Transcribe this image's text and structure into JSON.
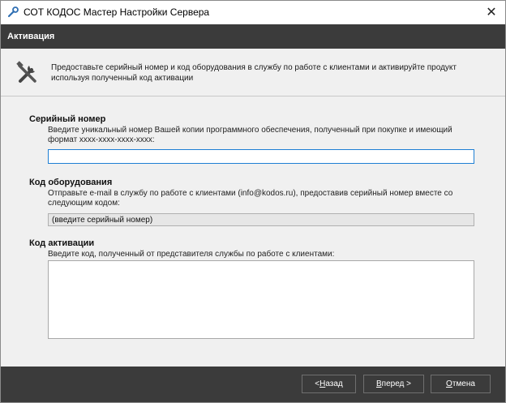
{
  "window": {
    "title": "СОТ КОДОС Мастер Настройки Сервера",
    "close_glyph": "✕"
  },
  "header": {
    "step_title": "Активация"
  },
  "intro": {
    "icon": "tools-icon",
    "text": "Предоставьте серийный номер и код оборудования в службу по работе с клиентами и активируйте продукт используя полученный код активации"
  },
  "serial": {
    "title": "Серийный номер",
    "description": "Введите уникальный номер Вашей копии программного обеспечения, полученный при покупке и имеющий формат xxxx-xxxx-xxxx-xxxx:",
    "value": ""
  },
  "hardware": {
    "title": "Код оборудования",
    "description": "Отправьте e-mail в службу по работе с клиентами (info@kodos.ru), предоставив серийный номер вместе со следующим кодом:",
    "value": "(введите серийный номер)"
  },
  "activation": {
    "title": "Код активации",
    "description": "Введите код, полученный от представителя службы по работе с клиентами:",
    "value": ""
  },
  "buttons": {
    "back_prefix": "< ",
    "back_mnemonic": "Н",
    "back_rest": "азад",
    "next_mnemonic": "В",
    "next_rest": "перед >",
    "cancel_mnemonic": "О",
    "cancel_rest": "тмена"
  },
  "colors": {
    "header_bg": "#3b3b3b",
    "focus_border": "#1e7fd4"
  }
}
